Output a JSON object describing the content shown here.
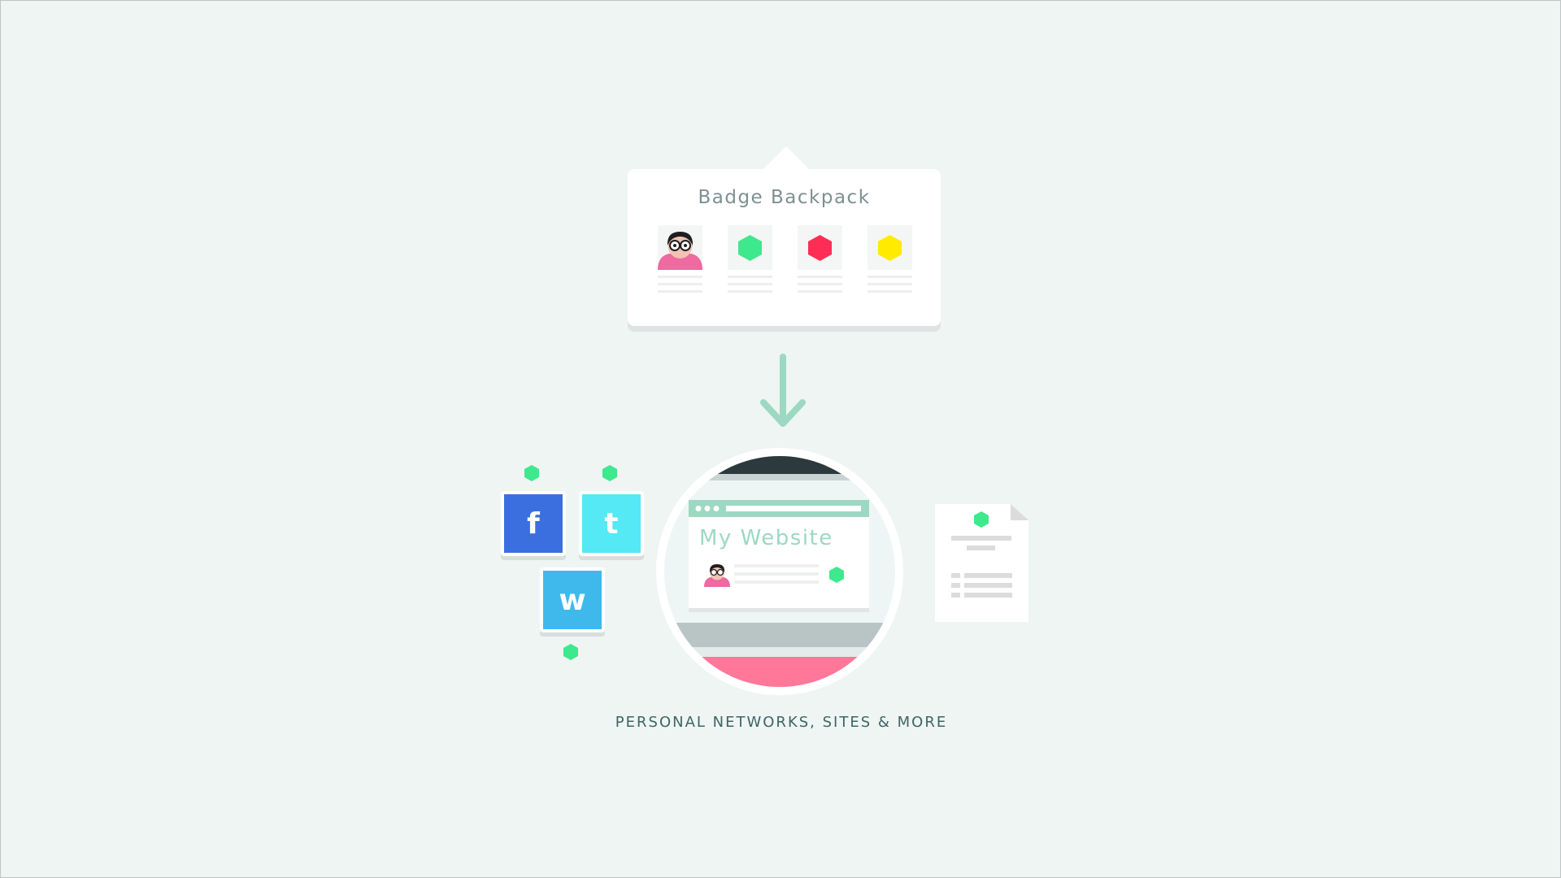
{
  "backpack": {
    "title": "Badge Backpack"
  },
  "colors": {
    "background": "#eef5f3",
    "accent_green": "#3ee88c",
    "badge_red": "#ff2d55",
    "badge_yellow": "#ffea00",
    "arrow": "#9dd8c2",
    "facebook_blue": "#3b6fe0",
    "tumblr_cyan": "#55e8f5",
    "wordpress_blue": "#3fb9ec",
    "avatar_pink": "#ee6aa0"
  },
  "social": {
    "facebook": {
      "letter": "f",
      "icon": "facebook-icon"
    },
    "tumblr": {
      "letter": "t",
      "icon": "tumblr-icon"
    },
    "wordpress": {
      "letter": "w",
      "icon": "wordpress-icon"
    }
  },
  "website": {
    "title": "My Website"
  },
  "caption": "PERSONAL NETWORKS, SITES & MORE"
}
